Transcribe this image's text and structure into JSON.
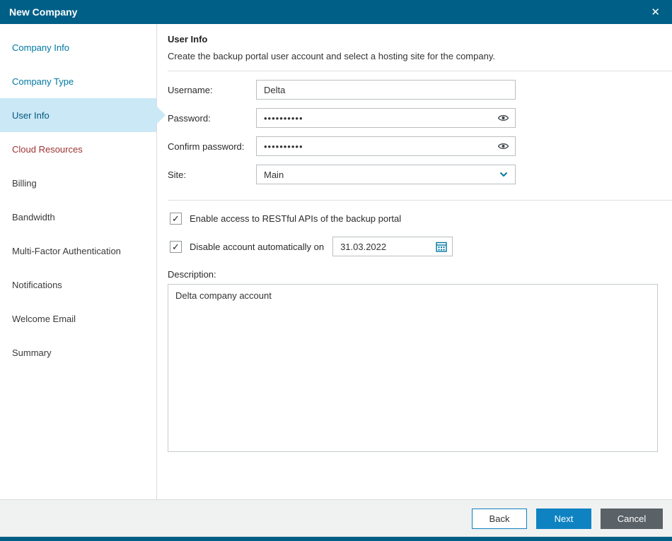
{
  "window": {
    "title": "New Company"
  },
  "icons": {
    "close": "✕",
    "checkmark": "✓"
  },
  "colors": {
    "titlebar": "#005f87",
    "link": "#0078a3",
    "selected_bg": "#cbe8f6",
    "error_step": "#9e3232",
    "next_button": "#0f83c2",
    "cancel_button": "#5a6167"
  },
  "sidebar": {
    "items": [
      {
        "label": "Company Info"
      },
      {
        "label": "Company Type"
      },
      {
        "label": "User Info"
      },
      {
        "label": "Cloud Resources"
      },
      {
        "label": "Billing"
      },
      {
        "label": "Bandwidth"
      },
      {
        "label": "Multi-Factor Authentication"
      },
      {
        "label": "Notifications"
      },
      {
        "label": "Welcome Email"
      },
      {
        "label": "Summary"
      }
    ]
  },
  "content": {
    "heading": "User Info",
    "subtitle": "Create the backup portal user account and select a hosting site for the company.",
    "username_label": "Username:",
    "username_value": "Delta",
    "password_label": "Password:",
    "password_value": "••••••••••",
    "confirm_label": "Confirm password:",
    "confirm_value": "••••••••••",
    "site_label": "Site:",
    "site_value": "Main",
    "rest_checkbox_label": "Enable access to RESTful APIs of the backup portal",
    "rest_checked": true,
    "disable_checkbox_label": "Disable account automatically on",
    "disable_checked": true,
    "disable_date": "31.03.2022",
    "description_label": "Description:",
    "description_value": "Delta company account"
  },
  "footer": {
    "back": "Back",
    "next": "Next",
    "cancel": "Cancel"
  }
}
